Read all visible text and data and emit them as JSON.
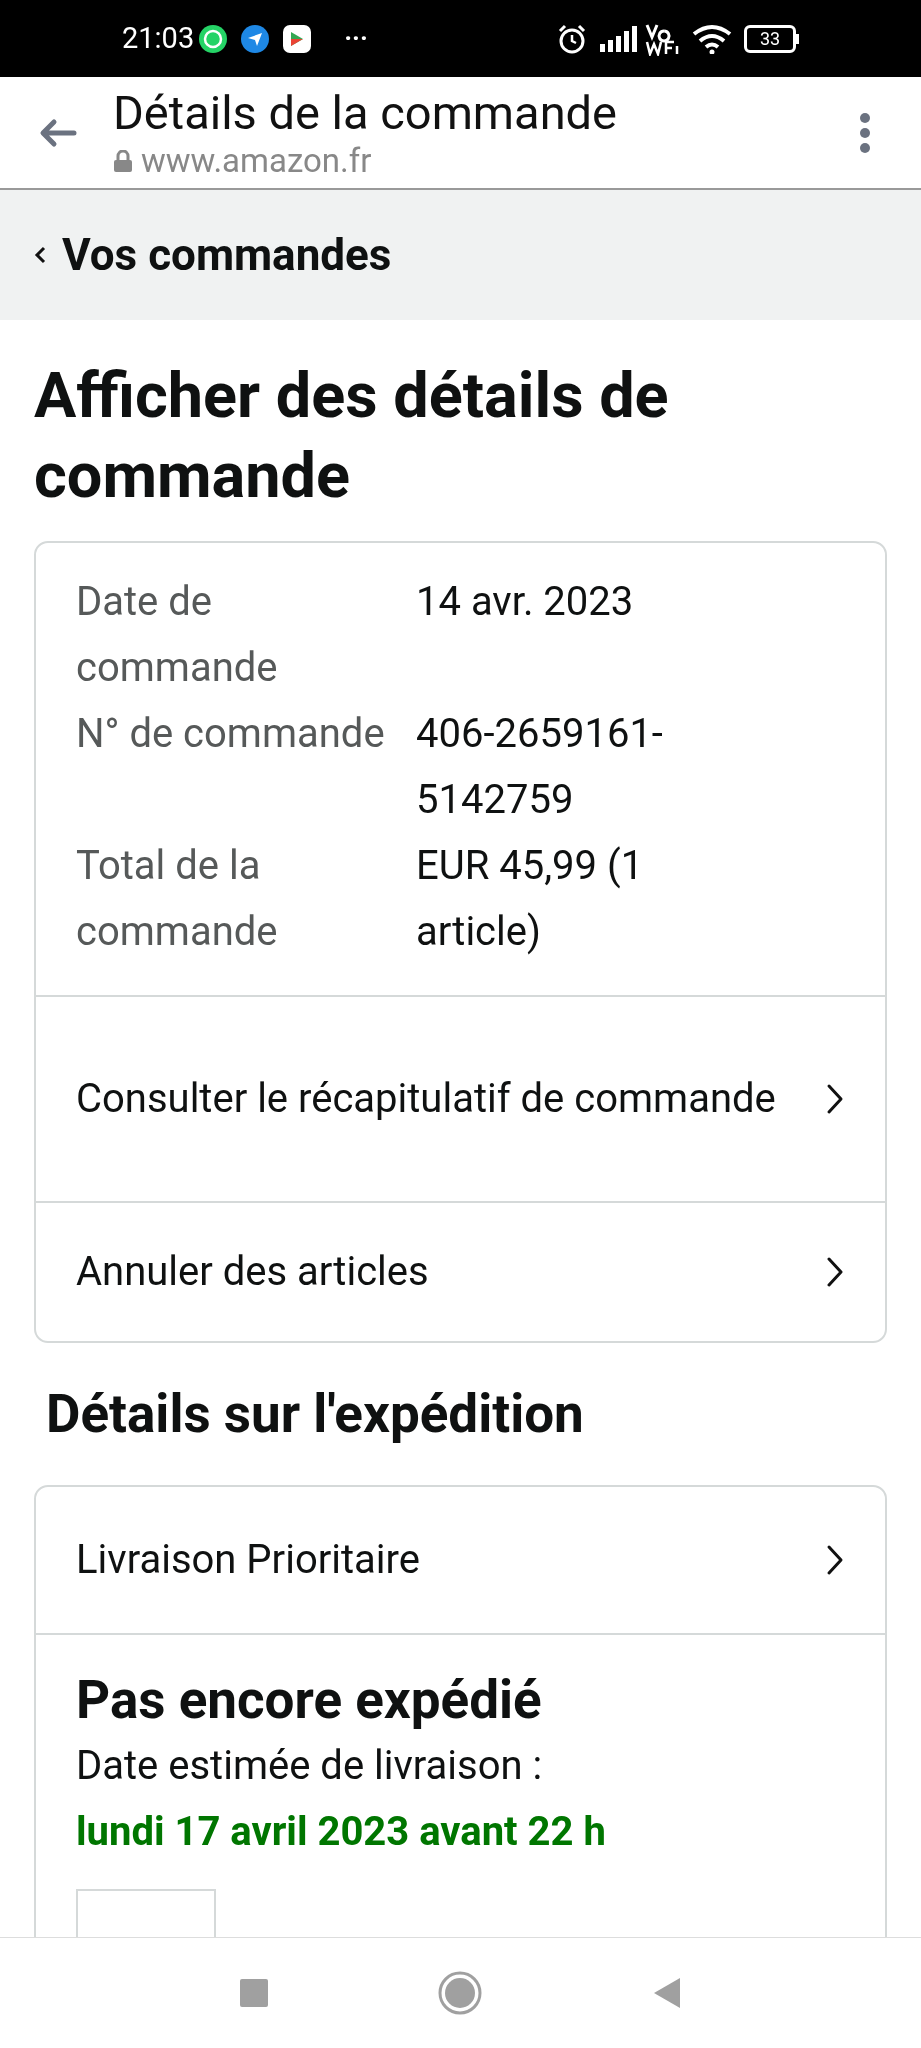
{
  "status_bar": {
    "time": "21:03",
    "more": "···",
    "battery": "33"
  },
  "browser": {
    "title": "Détails de la commande",
    "url": "www.amazon.fr"
  },
  "breadcrumb": {
    "label": "Vos commandes"
  },
  "heading": "Afficher des détails de commande",
  "summary": {
    "rows": [
      {
        "label": "Date de commande",
        "value": "14 avr. 2023"
      },
      {
        "label": "N° de commande",
        "value": "406-2659161-5142759"
      },
      {
        "label": "Total de la commande",
        "value": "EUR 45,99 (1 article)"
      }
    ],
    "links": [
      "Consulter le récapitulatif de commande",
      "Annuler des articles"
    ]
  },
  "shipping": {
    "heading": "Détails sur l'expédition",
    "method": "Livraison Prioritaire",
    "status": "Pas encore expédié",
    "estimate_label": "Date estimée de livraison :",
    "estimate_date": "lundi 17 avril 2023 avant 22 h"
  }
}
